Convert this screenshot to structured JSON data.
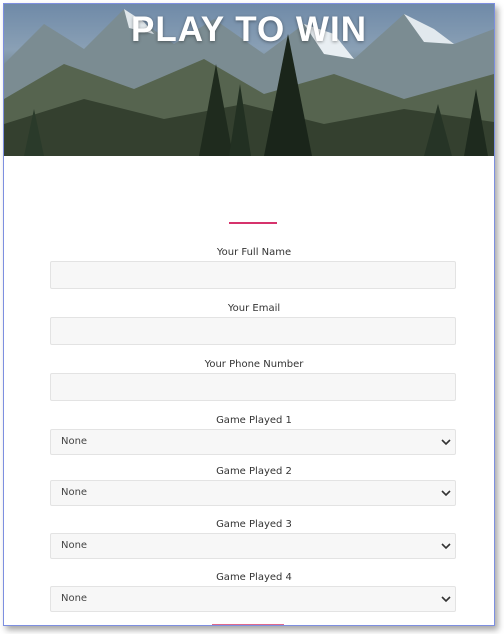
{
  "hero": {
    "title": "PLAY TO WIN"
  },
  "form": {
    "full_name_label": "Your Full Name",
    "email_label": "Your Email",
    "phone_label": "Your Phone Number",
    "games": [
      {
        "label": "Game Played 1",
        "value": "None"
      },
      {
        "label": "Game Played 2",
        "value": "None"
      },
      {
        "label": "Game Played 3",
        "value": "None"
      },
      {
        "label": "Game Played 4",
        "value": "None"
      }
    ]
  },
  "colors": {
    "accent": "#d6336c",
    "field_bg": "#f7f7f7"
  }
}
